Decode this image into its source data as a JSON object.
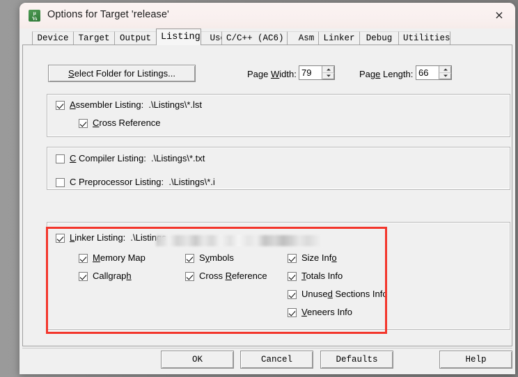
{
  "window": {
    "title": "Options for Target 'release'",
    "app_icon": "uvision-icon",
    "icon_glyph_top": "μ",
    "icon_glyph_bottom": "Vs",
    "close_label": "×"
  },
  "tabs": [
    {
      "label": "Device",
      "selected": false
    },
    {
      "label": "Target",
      "selected": false
    },
    {
      "label": "Output",
      "selected": false
    },
    {
      "label": "Listing",
      "selected": true
    },
    {
      "label": "User",
      "selected": false
    },
    {
      "label": "C/C++ (AC6)",
      "selected": false
    },
    {
      "label": "Asm",
      "selected": false
    },
    {
      "label": "Linker",
      "selected": false
    },
    {
      "label": "Debug",
      "selected": false
    },
    {
      "label": "Utilities",
      "selected": false
    }
  ],
  "toolbar": {
    "select_folder_label": "Select Folder for Listings...",
    "page_width_label": "Page Width:",
    "page_width_value": "79",
    "page_length_label": "Page Length:",
    "page_length_value": "66"
  },
  "assembler_group": {
    "main": {
      "label": "Assembler Listing:  .\\Listings\\*.lst",
      "checked": true
    },
    "cross_reference": {
      "label": "Cross Reference",
      "checked": true
    }
  },
  "compiler_group": {
    "c_compiler": {
      "label": "C Compiler Listing:  .\\Listings\\*.txt",
      "checked": false
    },
    "c_preprocessor": {
      "label": "C Preprocessor Listing:  .\\Listings\\*.i",
      "checked": false
    }
  },
  "linker_group": {
    "main": {
      "label": "Linker Listing:  .\\Listings",
      "checked": true,
      "path_redacted": true
    },
    "options": [
      {
        "label": "Memory Map",
        "checked": true,
        "col": 1,
        "row": 1
      },
      {
        "label": "Callgraph",
        "checked": true,
        "col": 1,
        "row": 2
      },
      {
        "label": "Symbols",
        "checked": true,
        "col": 2,
        "row": 1
      },
      {
        "label": "Cross Reference",
        "checked": true,
        "col": 2,
        "row": 2
      },
      {
        "label": "Size Info",
        "checked": true,
        "col": 3,
        "row": 1
      },
      {
        "label": "Totals Info",
        "checked": true,
        "col": 3,
        "row": 2
      },
      {
        "label": "Unused Sections Info",
        "checked": true,
        "col": 3,
        "row": 3
      },
      {
        "label": "Veneers Info",
        "checked": true,
        "col": 3,
        "row": 4
      }
    ],
    "highlight_color": "#f3352b"
  },
  "footer": {
    "ok": "OK",
    "cancel": "Cancel",
    "defaults": "Defaults",
    "help": "Help"
  }
}
